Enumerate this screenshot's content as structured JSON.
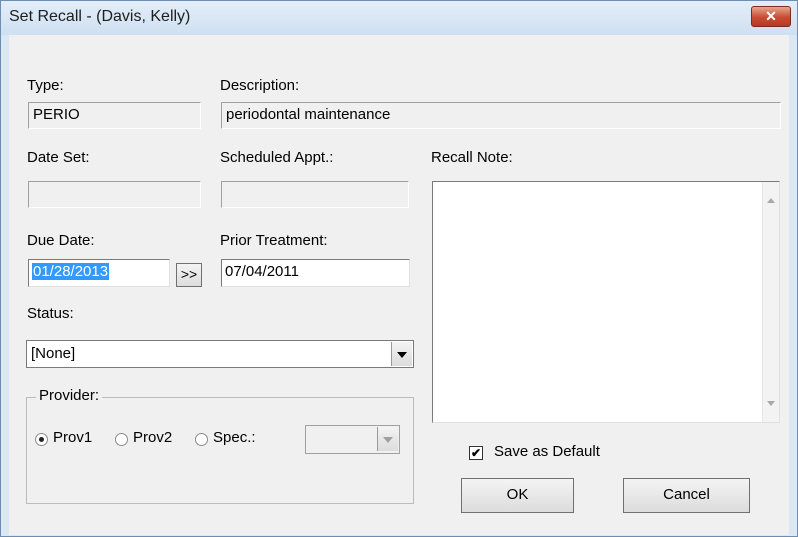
{
  "window": {
    "title": "Set Recall - (Davis, Kelly)",
    "close_icon": "close-icon"
  },
  "type": {
    "label": "Type:",
    "value": "PERIO"
  },
  "description": {
    "label": "Description:",
    "value": "periodontal maintenance"
  },
  "date_set": {
    "label": "Date Set:",
    "value": ""
  },
  "scheduled_appt": {
    "label": "Scheduled Appt.:",
    "value": ""
  },
  "recall_note": {
    "label": "Recall Note:",
    "value": ""
  },
  "due_date": {
    "label": "Due Date:",
    "value": "01/28/2013",
    "advance_button": ">>"
  },
  "prior_treatment": {
    "label": "Prior Treatment:",
    "value": "07/04/2011"
  },
  "status": {
    "label": "Status:",
    "value": "[None]"
  },
  "provider": {
    "label": "Provider:",
    "options": [
      "Prov1",
      "Prov2",
      "Spec.:"
    ],
    "selected": "Prov1",
    "spec_value": ""
  },
  "save_as_default": {
    "label": "Save as Default",
    "checked": true
  },
  "buttons": {
    "ok": "OK",
    "cancel": "Cancel"
  },
  "colors": {
    "title_bar": "#dbe8f4",
    "close_button": "#c84b33",
    "selection": "#3399ff",
    "dialog_bg": "#f0f0f0"
  }
}
